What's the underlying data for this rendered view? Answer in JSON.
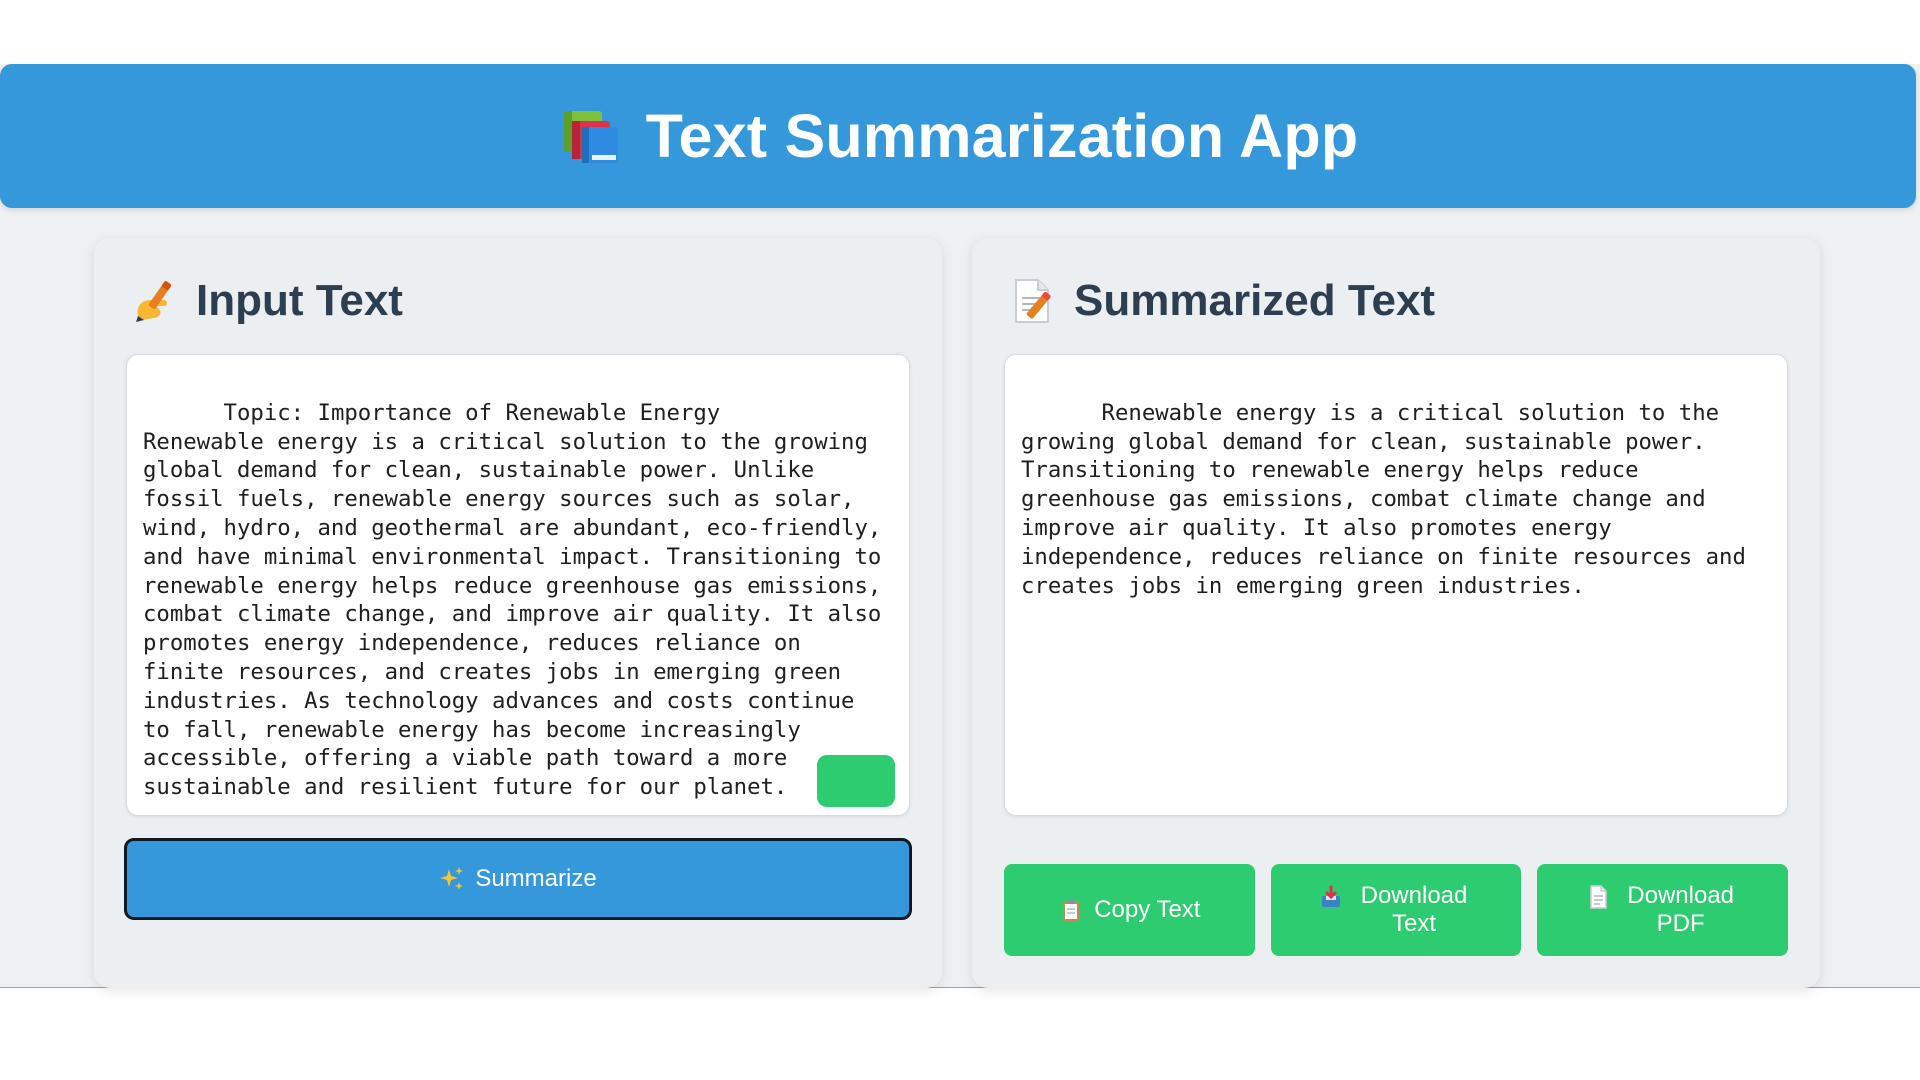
{
  "header": {
    "title": "Text Summarization App",
    "icon": "books-icon"
  },
  "input_panel": {
    "heading": "Input Text",
    "heading_icon": "writing-hand-icon",
    "text": "Topic: Importance of Renewable Energy\nRenewable energy is a critical solution to the growing global demand for clean, sustainable power. Unlike fossil fuels, renewable energy sources such as solar, wind, hydro, and geothermal are abundant, eco-friendly, and have minimal environmental impact. Transitioning to renewable energy helps reduce greenhouse gas emissions, combat climate change, and improve air quality. It also promotes energy independence, reduces reliance on finite resources, and creates jobs in emerging green industries. As technology advances and costs continue to fall, renewable energy has become increasingly accessible, offering a viable path toward a more sustainable and resilient future for our planet.",
    "upload_icon": "inbox-tray-icon",
    "summarize_label": "Summarize",
    "summarize_icon": "sparkles-icon"
  },
  "output_panel": {
    "heading": "Summarized Text",
    "heading_icon": "memo-icon",
    "text": "Renewable energy is a critical solution to the growing global demand for clean, sustainable power. Transitioning to renewable energy helps reduce greenhouse gas emissions, combat climate change and improve air quality. It also promotes energy independence, reduces reliance on finite resources and creates jobs in emerging green industries.",
    "buttons": [
      {
        "label": "Copy Text",
        "icon": "clipboard-icon"
      },
      {
        "label": "Download Text",
        "icon": "inbox-tray-icon"
      },
      {
        "label": "Download PDF",
        "icon": "page-icon"
      }
    ]
  },
  "colors": {
    "header_bg": "#3498db",
    "panel_bg": "#eceff1",
    "heading_text": "#2c3e50",
    "green_button": "#2ecc71",
    "blue_button": "#3498db"
  }
}
